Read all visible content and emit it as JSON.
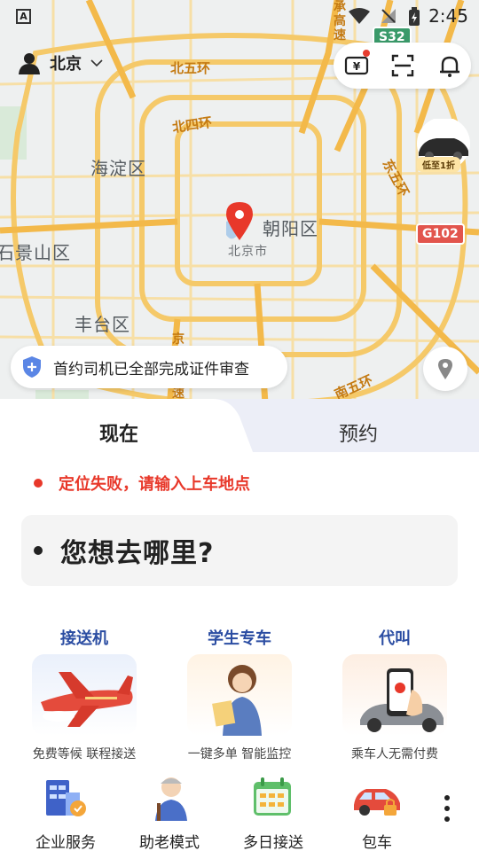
{
  "status_bar": {
    "time": "2:45",
    "a_icon": "A"
  },
  "header": {
    "city": "北京"
  },
  "map": {
    "labels": {
      "haidian": "海淀区",
      "chaoyang": "朝阳区",
      "fengtai": "丰台区",
      "shijingshan": "石景山区",
      "beijing_city": "北京市"
    },
    "rings": {
      "north5": "北五环",
      "north4": "北四环",
      "east5": "东五环",
      "south5": "南五环",
      "chenggao": "承高速",
      "jing": "京",
      "su": "速"
    },
    "highways": {
      "s32": "S32",
      "g102": "G102"
    }
  },
  "promo": {
    "tag": "低至1折"
  },
  "notice": {
    "text": "首约司机已全部完成证件审查"
  },
  "tabs": {
    "now": "现在",
    "book": "预约"
  },
  "warning": {
    "text": "定位失败，请输入上车地点"
  },
  "destination": {
    "placeholder": "您想去哪里?"
  },
  "services": [
    {
      "title": "接送机",
      "subtitle": "免费等候 联程接送"
    },
    {
      "title": "学生专车",
      "subtitle": "一键多单 智能监控"
    },
    {
      "title": "代叫",
      "subtitle": "乘车人无需付费"
    }
  ],
  "quick": [
    {
      "label": "企业服务"
    },
    {
      "label": "助老模式"
    },
    {
      "label": "多日接送"
    },
    {
      "label": "包车"
    }
  ],
  "colors": {
    "accent_red": "#e8382a",
    "service_blue": "#2b4da2",
    "road_yellow": "#f5c969"
  }
}
